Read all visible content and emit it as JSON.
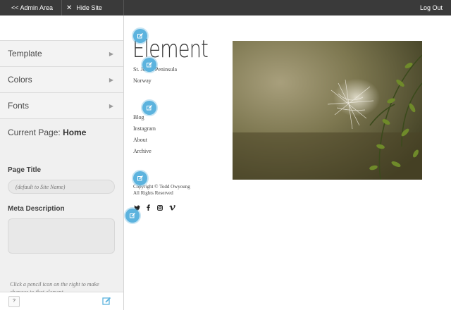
{
  "topbar": {
    "admin_label": "<< Admin Area",
    "hide_label": "Hide Site Builder",
    "logout_label": "Log Out"
  },
  "sidebar": {
    "items": [
      {
        "label": "Template"
      },
      {
        "label": "Colors"
      },
      {
        "label": "Fonts"
      }
    ],
    "current_prefix": "Current Page:",
    "current_page": "Home",
    "page_title_label": "Page Title",
    "page_title_placeholder": "(default to Site Name)",
    "meta_label": "Meta Description",
    "meta_value": "",
    "help_text": "Click a pencil icon on the right to make changes to that element.",
    "help_button": "?"
  },
  "site": {
    "brand": "Element",
    "location_line1": "St. Johns Peninsula",
    "location_line2": "Norway",
    "nav": [
      "Blog",
      "Instagram",
      "About",
      "Archive"
    ],
    "copyright_line1": "Copyright © Todd Owyoung",
    "copyright_line2": "All Rights Reserved",
    "social_icons": [
      "twitter-icon",
      "facebook-icon",
      "instagram-icon",
      "vimeo-icon"
    ]
  },
  "colors": {
    "topbar": "#3a3a3a",
    "accent": "#5cb3de",
    "sidebar_bg": "#f0f0f0"
  }
}
